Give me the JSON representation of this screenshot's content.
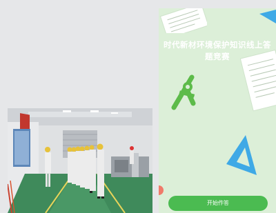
{
  "quiz": {
    "title_line1": "时代新材环境保护知识线上答",
    "title_line2": "题竞赛",
    "start_label": "开始作答"
  },
  "colors": {
    "card_bg": "#dcefd8",
    "button": "#4bbb51",
    "compass": "#5dbb4a",
    "triangle": "#3fa9e6",
    "page_bg": "#e6e7e9"
  },
  "icons": [
    "compass-icon",
    "triangle-ruler-icon",
    "paper-sheet-icon"
  ]
}
